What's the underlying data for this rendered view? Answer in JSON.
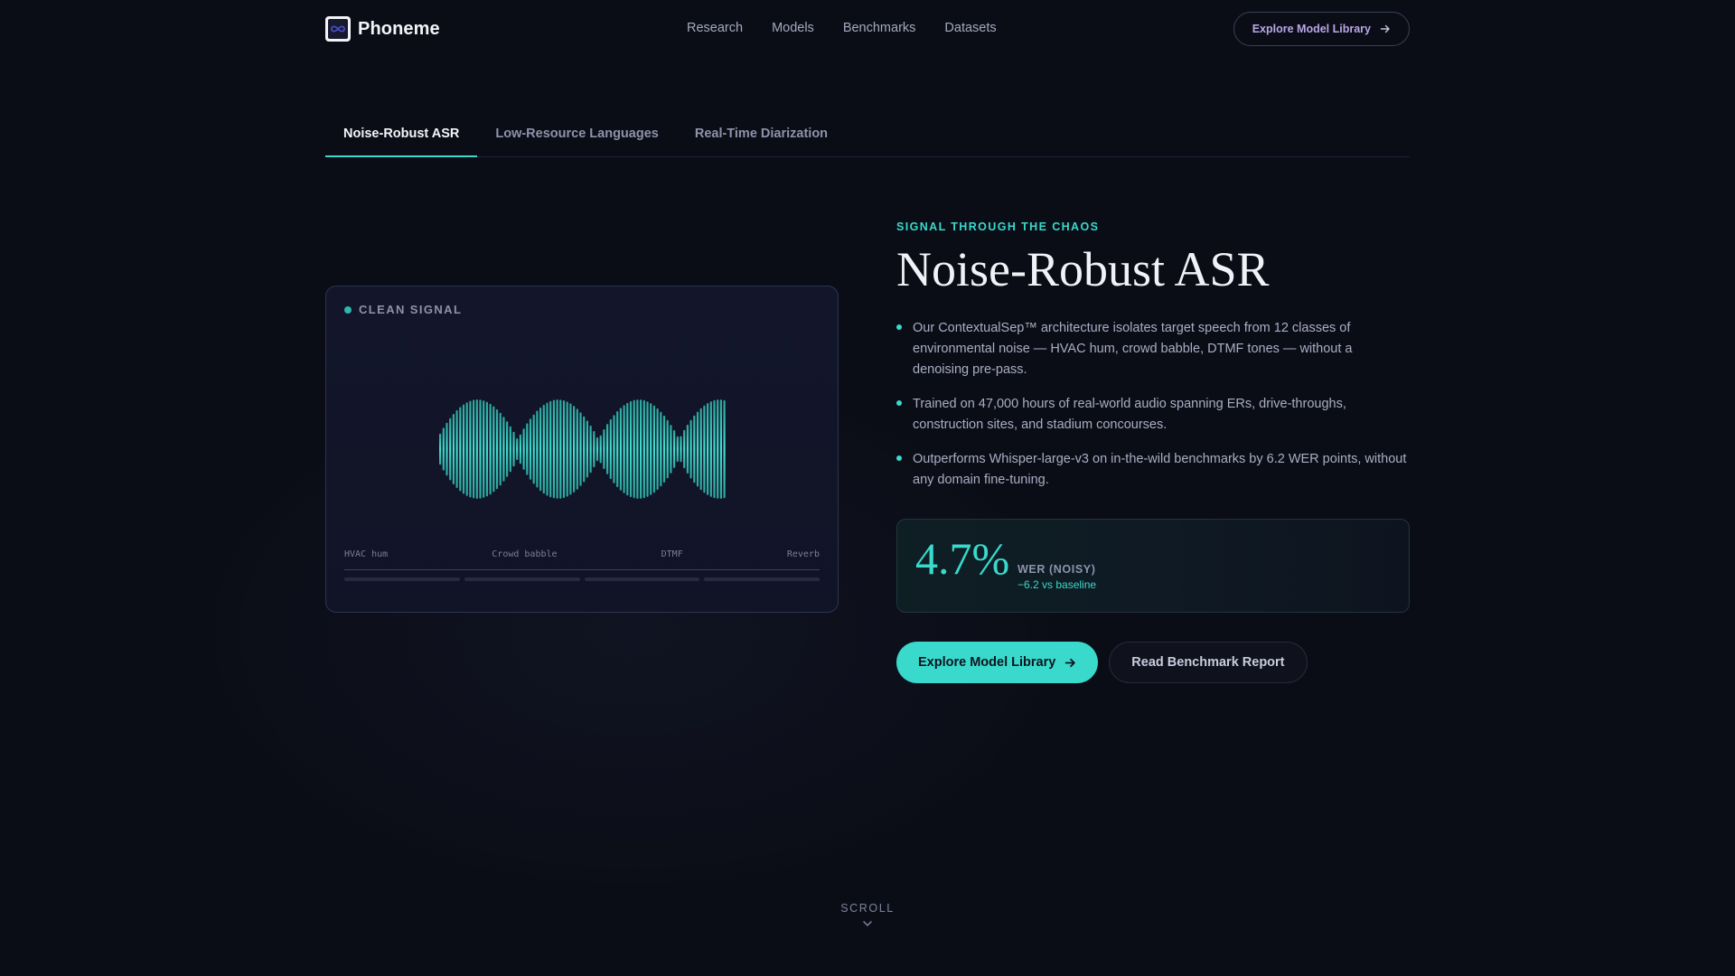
{
  "brand": {
    "name": "Phoneme",
    "accent": "#39d9cc"
  },
  "nav": {
    "items": [
      "Research",
      "Models",
      "Benchmarks",
      "Datasets"
    ]
  },
  "header": {
    "cta_label": "Explore Model Library"
  },
  "tabs": [
    {
      "label": "Noise-Robust ASR",
      "active": true
    },
    {
      "label": "Low-Resource Languages",
      "active": false
    },
    {
      "label": "Real-Time Diarization",
      "active": false
    }
  ],
  "visual": {
    "status_label": "CLEAN SIGNAL",
    "noise_classes": [
      "HVAC hum",
      "Crowd babble",
      "DTMF",
      "Reverb"
    ]
  },
  "hero": {
    "eyebrow": "SIGNAL THROUGH THE CHAOS",
    "title": "Noise-Robust ASR",
    "bullets": [
      "Our ContextualSep™ architecture isolates target speech from 12 classes of environmental noise — HVAC hum, crowd babble, DTMF tones — without a denoising pre-pass.",
      "Trained on 47,000 hours of real-world audio spanning ERs, drive-throughs, construction sites, and stadium concourses.",
      "Outperforms Whisper-large-v3 on in-the-wild benchmarks by 6.2 WER points, without any domain fine-tuning."
    ],
    "stat": {
      "value": "4.7%",
      "label": "WER (NOISY)",
      "delta": "−6.2 vs baseline"
    },
    "primary_cta": "Explore Model Library",
    "secondary_cta": "Read Benchmark Report"
  },
  "scroll_hint": "SCROLL"
}
